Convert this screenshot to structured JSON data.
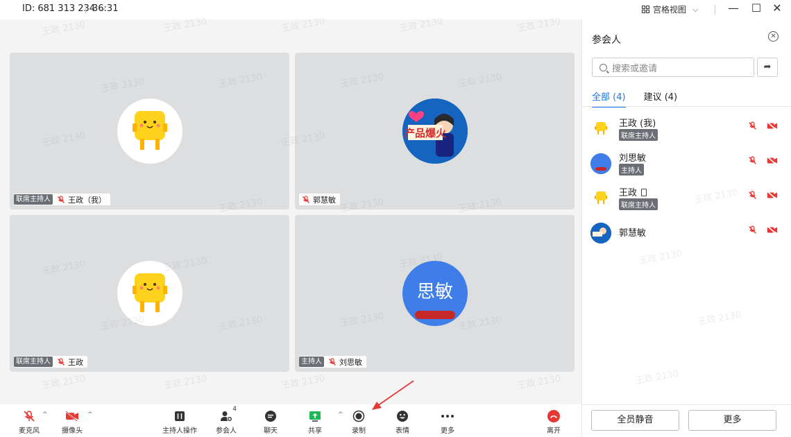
{
  "titlebar": {
    "meeting_id": "ID: 681 313 234",
    "timer": "36:31",
    "view_label": "宫格视图"
  },
  "tiles": [
    {
      "role": "联席主持人",
      "name": "王政（我）",
      "avatar": "yellow-mascot"
    },
    {
      "role": "",
      "name": "郭慧敏",
      "avatar": "product-promo"
    },
    {
      "role": "联席主持人",
      "name": "王政",
      "avatar": "yellow-mascot"
    },
    {
      "role": "主持人",
      "name": "刘思敏",
      "avatar": "思敏"
    }
  ],
  "toolbar": {
    "mic": "麦克风",
    "camera": "摄像头",
    "host_ops": "主持人操作",
    "participants": "参会人",
    "participants_count": "4",
    "chat": "聊天",
    "share": "共享",
    "record": "录制",
    "reactions": "表情",
    "more": "更多",
    "leave": "离开"
  },
  "panel": {
    "title": "参会人",
    "search_placeholder": "搜索或邀请",
    "tab_all": "全部 (4)",
    "tab_suggest": "建议 (4)",
    "participants": [
      {
        "name": "王政 (我)",
        "tag": "联席主持人"
      },
      {
        "name": "刘思敏",
        "tag": "主持人"
      },
      {
        "name": "王政",
        "tag": "联席主持人"
      },
      {
        "name": "郭慧敏",
        "tag": ""
      }
    ],
    "mute_all": "全员静音",
    "more": "更多"
  },
  "watermark_text": "王政 2130",
  "colors": {
    "accent": "#1a73e8",
    "danger": "#e53935",
    "tile_bg": "#dcdee0"
  },
  "icons": [
    "chevron-down-icon",
    "grid-view-icon",
    "minimize-icon",
    "maximize-icon",
    "close-icon",
    "mic-off-icon",
    "camera-off-icon",
    "host-ops-icon",
    "participants-icon",
    "chat-icon",
    "share-icon",
    "record-icon",
    "reactions-icon",
    "more-icon",
    "leave-icon",
    "search-icon",
    "share-link-icon"
  ]
}
